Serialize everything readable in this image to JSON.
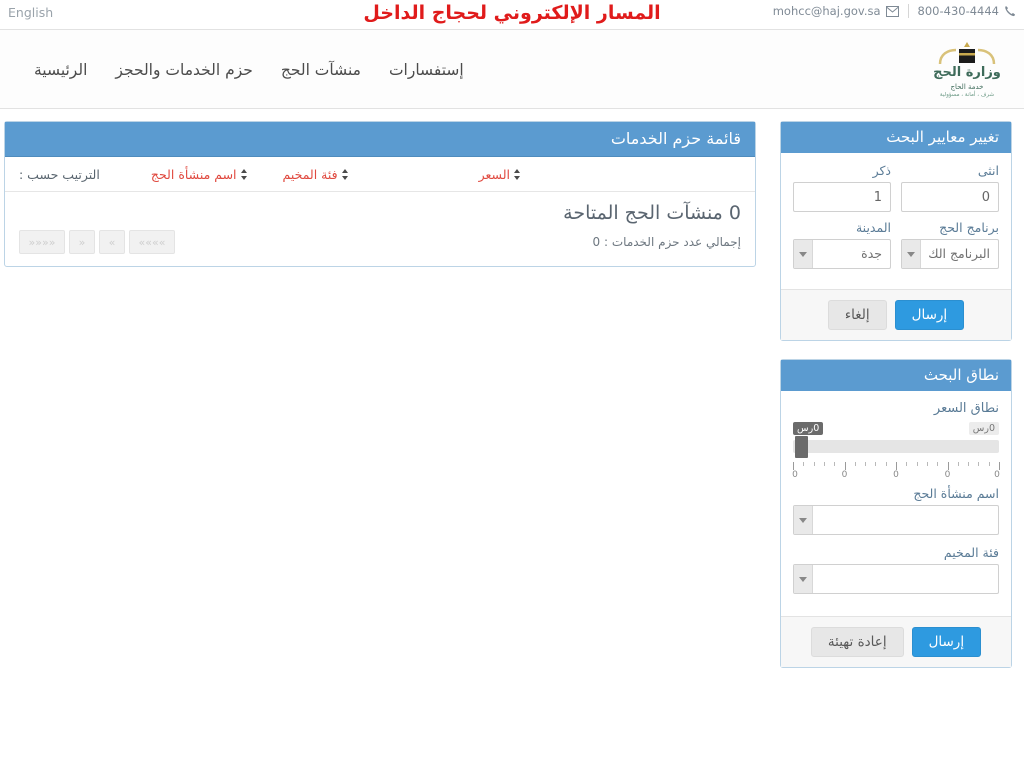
{
  "topbar": {
    "lang_link": "English",
    "site_title": "المسار الإلكتروني لحجاج الداخل",
    "email": "mohcc@haj.gov.sa",
    "phone": "800-430-4444",
    "email_icon": "envelope-icon",
    "phone_icon": "phone-icon"
  },
  "nav": {
    "items": [
      {
        "label": "الرئيسية"
      },
      {
        "label": "حزم الخدمات والحجز"
      },
      {
        "label": "منشآت الحج"
      },
      {
        "label": "إستفسارات"
      }
    ]
  },
  "brand": {
    "name": "وزارة الحج",
    "sub1": "خدمة الحاج",
    "sub2": "شرف ، أمانة ، مسؤولية"
  },
  "main_panel": {
    "title": "قائمة حزم الخدمات",
    "sort_label": "الترتيب حسب :",
    "sort_options": [
      {
        "label": "اسم منشأة الحج"
      },
      {
        "label": "فئة المخيم"
      },
      {
        "label": "السعر"
      }
    ],
    "results_heading": "0 منشآت الحج المتاحة",
    "total_text": "إجمالي عدد حزم الخدمات : 0",
    "pager": [
      {
        "label": "»»»»",
        "name": "pager-last"
      },
      {
        "label": "»",
        "name": "pager-next"
      },
      {
        "label": "«",
        "name": "pager-prev"
      },
      {
        "label": "««««",
        "name": "pager-first"
      }
    ]
  },
  "search_criteria": {
    "title": "تغيير معايير البحث",
    "male_label": "ذكر",
    "male_value": "1",
    "female_label": "انثى",
    "female_value": "0",
    "city_label": "المدينة",
    "city_value": "جدة",
    "program_label": "برنامج الحج",
    "program_value": "البرنامج الك",
    "submit_label": "إرسال",
    "cancel_label": "إلغاء"
  },
  "search_scope": {
    "title": "نطاق البحث",
    "price_range_label": "نطاق السعر",
    "price_min_tip": "0رس",
    "price_max_tip": "0رس",
    "ruler_labels": [
      "0",
      "0",
      "0",
      "0",
      "0"
    ],
    "facility_label": "اسم منشأة الحج",
    "facility_value": "",
    "camp_label": "فئة المخيم",
    "camp_value": "",
    "submit_label": "إرسال",
    "reset_label": "إعادة تهيئة"
  },
  "colors": {
    "panel_header": "#5b9bd0",
    "primary_button": "#2e9ae0",
    "title_red": "#e01b1b",
    "sort_link_red": "#e0493f",
    "label_blue": "#5a7b96"
  }
}
